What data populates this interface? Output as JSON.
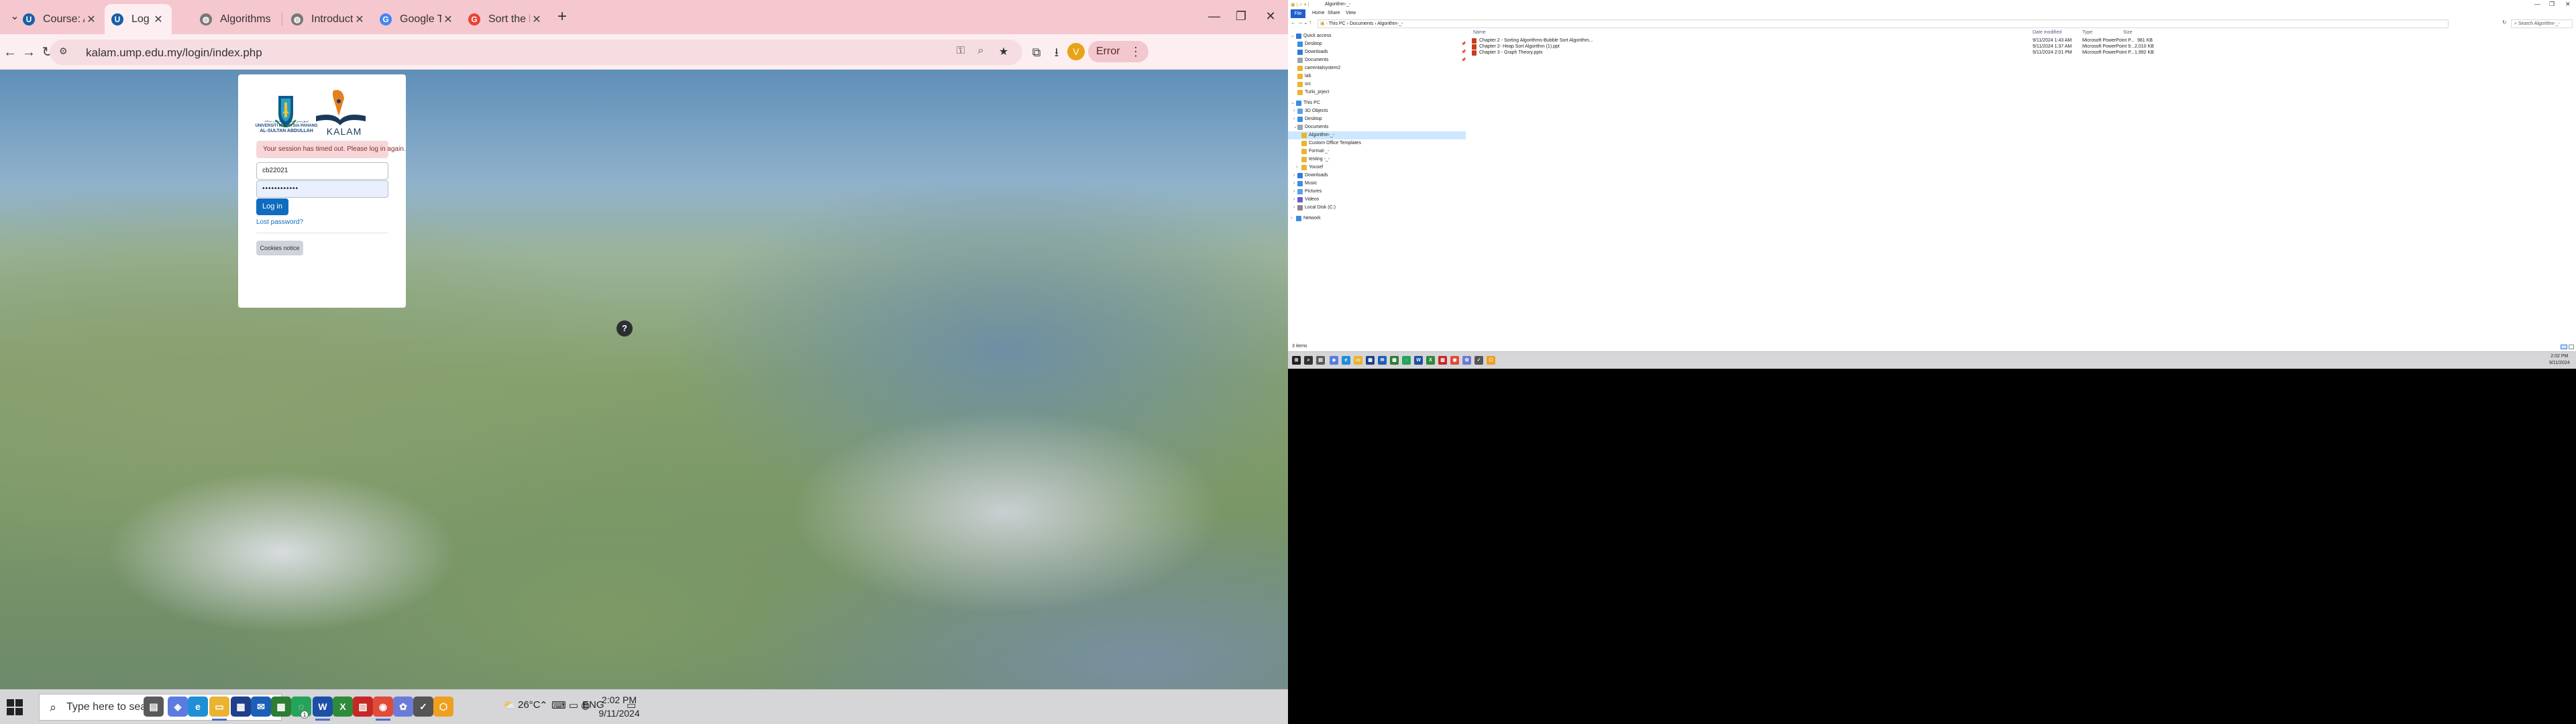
{
  "browser": {
    "tabs": [
      {
        "title": "Course: ALGORITHM & CO",
        "active": false,
        "favicon": "moodle-icon"
      },
      {
        "title": "Log in to the site | KALAM",
        "active": true,
        "favicon": "moodle-icon"
      },
      {
        "title": "Algorithms Notes for Profe",
        "active": false,
        "favicon": "globe-icon"
      },
      {
        "title": "Introduction to Algorithm",
        "active": false,
        "favicon": "globe-icon"
      },
      {
        "title": "Google Translate",
        "active": false,
        "favicon": "translate-icon"
      },
      {
        "title": "Sort the heap using heap",
        "active": false,
        "favicon": "google-icon"
      }
    ],
    "url": "kalam.ump.edu.my/login/index.php",
    "profile_initial": "V",
    "error_label": "Error",
    "accent": "#f5c7cf"
  },
  "login": {
    "university_lines": [
      "UNIVERSITI MALAYSIA PAHANG",
      "AL-SULTAN ABDULLAH"
    ],
    "university_arabic": "اونيۏرسيتي مليسيا ڤهڠ السلطان عبدالله",
    "brand": "KALAM",
    "alert": "Your session has timed out. Please log in again.",
    "username": "cb22021",
    "password_mask": "••••••••••••",
    "login_button": "Log in",
    "lost_password": "Lost password?",
    "cookies_notice": "Cookies notice",
    "help": "?",
    "primary_color": "#0f6cbf"
  },
  "taskbar": {
    "search_placeholder": "Type here to search",
    "weather": "26°C",
    "language": "ENG",
    "time": "2:02 PM",
    "date": "9/11/2024",
    "whatsapp_badge": "1"
  },
  "explorer": {
    "title": "Algorithm-_-",
    "ribbon_tabs": [
      "File",
      "Home",
      "Share",
      "View"
    ],
    "breadcrumb": [
      "This PC",
      "Documents",
      "Algorithm-_-"
    ],
    "search_placeholder": "Search Algorithm-_-",
    "columns": {
      "name": "Name",
      "date": "Date modified",
      "type": "Type",
      "size": "Size"
    },
    "files": [
      {
        "name": "Chapter 2 - Sorting Algorithms-Bubble Sort Algorithm...",
        "date": "9/11/2024 1:43 AM",
        "type": "Microsoft PowerPoint P...",
        "size": "981 KB"
      },
      {
        "name": "Chapter 2- Heap Sort Algorithm (1).ppt",
        "date": "9/11/2024 1:37 AM",
        "type": "Microsoft PowerPoint 9...",
        "size": "2,010 KB"
      },
      {
        "name": "Chapter 3 - Graph Theory.pptx",
        "date": "9/11/2024 2:01 PM",
        "type": "Microsoft PowerPoint P...",
        "size": "1,992 KB"
      }
    ],
    "nav": {
      "quick_access": "Quick access",
      "quick_items": [
        "Desktop",
        "Downloads",
        "Documents",
        "carrentalsystem2",
        "lab",
        "src",
        "Turki_prject"
      ],
      "this_pc": "This PC",
      "pc_items": [
        "3D Objects",
        "Desktop",
        "Documents"
      ],
      "doc_items": [
        "Algorithm-_-",
        "Custom Office Templates",
        "Formal-_-",
        "testing -_-",
        "Yousef"
      ],
      "pc_items2": [
        "Downloads",
        "Music",
        "Pictures",
        "Videos",
        "Local Disk (C:)"
      ],
      "network": "Network"
    },
    "status": "3 items",
    "time": "2:02 PM",
    "date": "9/11/2024"
  }
}
